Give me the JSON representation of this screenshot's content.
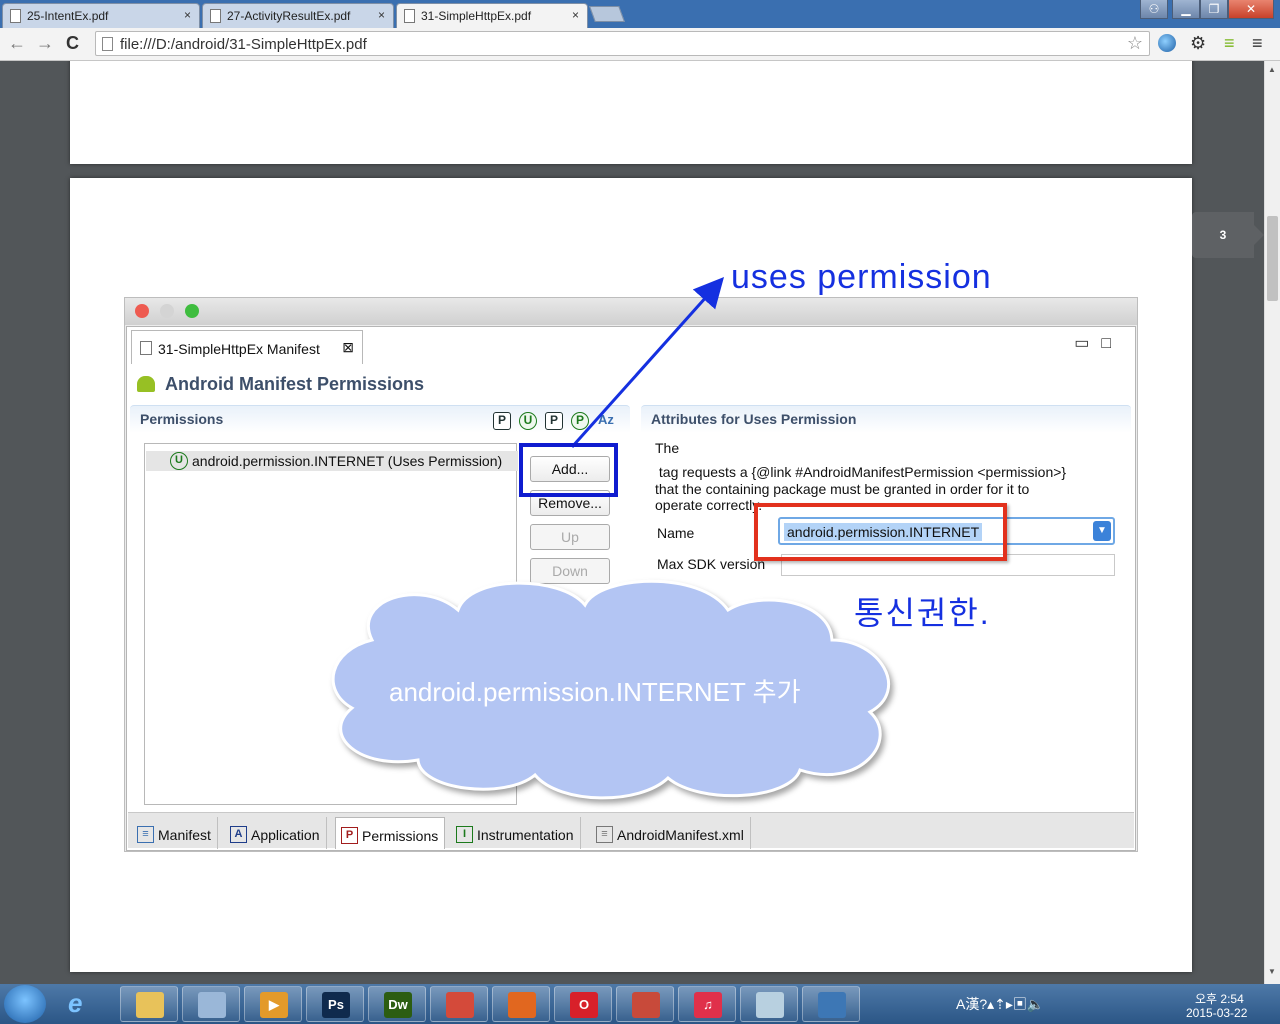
{
  "browser": {
    "tabs": [
      {
        "title": "25-IntentEx.pdf",
        "close": "×"
      },
      {
        "title": "27-ActivityResultEx.pdf",
        "close": "×"
      },
      {
        "title": "31-SimpleHttpEx.pdf",
        "close": "×"
      }
    ],
    "window_controls": {
      "minimize": "▁",
      "maximize": "❐",
      "close": "✕"
    },
    "nav": {
      "back": "←",
      "forward": "→",
      "reload": "C"
    },
    "url": "file:///D:/android/31-SimpleHttpEx.pdf",
    "star": "☆",
    "toolbar_icons": [
      "globe-icon",
      "gear-icon",
      "ladder-icon",
      "menu-icon"
    ],
    "toolbar_glyphs": {
      "settings": "⚙",
      "ladder": "≡",
      "menu": "≡"
    }
  },
  "pdf": {
    "page_number": "3"
  },
  "eclipse": {
    "editor_tab": "31-SimpleHttpEx Manifest",
    "editor_tab_close": "⊠",
    "minmax": "▭□",
    "form_title": "Android Manifest Permissions",
    "permissions_section": "Permissions",
    "attributes_section": "Attributes for Uses Permission",
    "sort_icons": [
      "P",
      "U",
      "P",
      "P",
      "Az"
    ],
    "permission_item": "android.permission.INTERNET (Uses Permission)",
    "permission_item_icon": "U",
    "buttons": {
      "add": "Add...",
      "remove": "Remove...",
      "up": "Up",
      "down": "Down"
    },
    "description_line1": "The",
    "description_line2": " tag requests a {@link #AndroidManifestPermission <permission>}",
    "description_line3": "that the containing package must be granted in order for it to",
    "description_line4": "operate correctly.",
    "name_label": "Name",
    "name_value": "android.permission.INTERNET",
    "max_sdk_label": "Max SDK version",
    "bottom_tabs": [
      {
        "label": "Manifest",
        "icon": "≡"
      },
      {
        "label": "Application",
        "icon": "A"
      },
      {
        "label": "Permissions",
        "icon": "P"
      },
      {
        "label": "Instrumentation",
        "icon": "I"
      },
      {
        "label": "AndroidManifest.xml",
        "icon": "≡"
      }
    ]
  },
  "annotations": {
    "uses_permission": "uses permission",
    "korean_note": "통신권한.",
    "cloud_text": "android.permission.INTERNET 추가"
  },
  "taskbar": {
    "pinned_apps": [
      {
        "name": "explorer-icon",
        "glyph": "",
        "color": "#e8c25a"
      },
      {
        "name": "search-app-icon",
        "glyph": "",
        "color": "#9ab7d8"
      },
      {
        "name": "media-player-icon",
        "glyph": "▶",
        "color": "#e39a2a"
      },
      {
        "name": "photoshop-icon",
        "glyph": "Ps",
        "color": "#0f2a4d"
      },
      {
        "name": "dreamweaver-icon",
        "glyph": "Dw",
        "color": "#2c5d12"
      },
      {
        "name": "chrome-icon",
        "glyph": "",
        "color": "#d44a3a"
      },
      {
        "name": "firefox-icon",
        "glyph": "",
        "color": "#e1671f"
      },
      {
        "name": "opera-icon",
        "glyph": "O",
        "color": "#d8202a"
      },
      {
        "name": "paint-tool-icon",
        "glyph": "",
        "color": "#c84a3a"
      },
      {
        "name": "itunes-icon",
        "glyph": "♫",
        "color": "#e0304a"
      },
      {
        "name": "notepad-icon",
        "glyph": "",
        "color": "#b8d0e0"
      },
      {
        "name": "image-viewer-icon",
        "glyph": "",
        "color": "#3d77b5"
      }
    ],
    "tray_glyphs": "A漢?▴⇡▸▣🔈",
    "time": "오후 2:54",
    "date": "2015-03-22"
  }
}
